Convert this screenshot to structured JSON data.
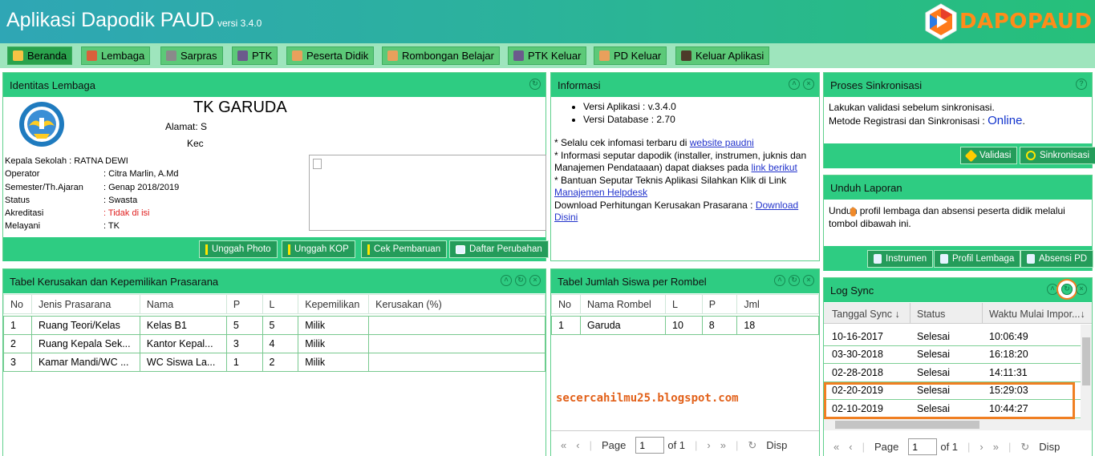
{
  "header": {
    "title": "Aplikasi Dapodik PAUD",
    "version": "versi 3.4.0",
    "logo_text": "DAPOPAUD"
  },
  "nav": [
    {
      "label": "Beranda",
      "icon": "home-icon",
      "active": true
    },
    {
      "label": "Lembaga",
      "icon": "building-icon"
    },
    {
      "label": "Sarpras",
      "icon": "chair-icon"
    },
    {
      "label": "PTK",
      "icon": "teacher-icon"
    },
    {
      "label": "Peserta Didik",
      "icon": "students-icon"
    },
    {
      "label": "Rombongan Belajar",
      "icon": "group-icon"
    },
    {
      "label": "PTK Keluar",
      "icon": "teacher-exit-icon"
    },
    {
      "label": "PD Keluar",
      "icon": "student-exit-icon"
    },
    {
      "label": "Keluar Aplikasi",
      "icon": "exit-door-icon"
    }
  ],
  "identitas": {
    "title": "Identitas Lembaga",
    "school_name": "TK GARUDA",
    "alamat_label": "Alamat:",
    "alamat_value": "S",
    "kec_label": "Kec",
    "rows": [
      {
        "label": "Kepala Sekolah : RATNA DEWI",
        "value": ""
      },
      {
        "label": "Operator",
        "value": ": Citra Marlin, A.Md"
      },
      {
        "label": "Semester/Th.Ajaran",
        "value": ": Genap 2018/2019"
      },
      {
        "label": "Status",
        "value": ": Swasta"
      },
      {
        "label": "Akreditasi",
        "value": ": Tidak di isi"
      },
      {
        "label": "Melayani",
        "value": ": TK"
      }
    ],
    "buttons": [
      "Unggah Photo",
      "Unggah KOP",
      "Cek Pembaruan",
      "Daftar Perubahan"
    ]
  },
  "informasi": {
    "title": "Informasi",
    "bullets": [
      "Versi Aplikasi : v.3.4.0",
      "Versi Database : 2.70"
    ],
    "line1_text": "* Selalu cek infomasi terbaru di ",
    "line1_link": "website paudni",
    "line2_text": "* Informasi seputar dapodik (installer, instrumen, juknis dan Manajemen Pendataaan) dapat diakses pada ",
    "line2_link": "link berikut",
    "line3_text": "* Bantuan Seputar Teknis Aplikasi Silahkan Klik di Link ",
    "line3_link": "Manajemen Helpdesk",
    "line4_text": "Download Perhitungan Kerusakan Prasarana : ",
    "line4_link": "Download Disini"
  },
  "sinkronisasi": {
    "title": "Proses Sinkronisasi",
    "line1": "Lakukan validasi sebelum sinkronisasi.",
    "line2": "Metode Registrasi dan Sinkronisasi : ",
    "status": "Online",
    "status_suffix": ".",
    "validasi": "Validasi",
    "sinkron": "Sinkronisasi"
  },
  "unduh": {
    "title": "Unduh Laporan",
    "text": "Unduh profil lembaga dan absensi peserta didik melalui tombol dibawah ini.",
    "buttons": [
      "Instrumen",
      "Profil Lembaga",
      "Absensi PD"
    ]
  },
  "prasarana": {
    "title": "Tabel Kerusakan dan Kepemilikan Prasarana",
    "columns": [
      "No",
      "Jenis Prasarana",
      "Nama",
      "P",
      "L",
      "Kepemilikan",
      "Kerusakan (%)"
    ],
    "rows": [
      [
        "1",
        "Ruang Teori/Kelas",
        "Kelas B1",
        "5",
        "5",
        "Milik",
        ""
      ],
      [
        "2",
        "Ruang Kepala Sek...",
        "Kantor Kepal...",
        "3",
        "4",
        "Milik",
        ""
      ],
      [
        "3",
        "Kamar Mandi/WC ...",
        "WC Siswa La...",
        "1",
        "2",
        "Milik",
        ""
      ]
    ]
  },
  "siswa": {
    "title": "Tabel Jumlah Siswa per Rombel",
    "columns": [
      "No",
      "Nama Rombel",
      "L",
      "P",
      "Jml"
    ],
    "rows": [
      [
        "1",
        "Garuda",
        "10",
        "8",
        "18"
      ]
    ],
    "pager": {
      "page_label": "Page",
      "page_value": "1",
      "of": "of 1",
      "disp": "Disp"
    }
  },
  "watermark": "secercahilmu25.blogspot.com",
  "logsync": {
    "title": "Log Sync",
    "columns": [
      "Tanggal Sync",
      "Status",
      "Waktu Mulai Impor..."
    ],
    "rows": [
      [
        "10-16-2017",
        "Selesai",
        "10:06:49"
      ],
      [
        "03-30-2018",
        "Selesai",
        "16:18:20"
      ],
      [
        "02-28-2018",
        "Selesai",
        "14:11:31"
      ],
      [
        "02-20-2019",
        "Selesai",
        "15:29:03"
      ],
      [
        "02-10-2019",
        "Selesai",
        "10:44:27"
      ]
    ],
    "pager": {
      "page_label": "Page",
      "page_value": "1",
      "of": "of 1",
      "disp": "Disp"
    }
  },
  "colors": {
    "header_green": "#2ecc82",
    "nav_bg": "#9ee5bd",
    "highlight": "#f07f22",
    "logo_orange": "#ff8c1a"
  }
}
